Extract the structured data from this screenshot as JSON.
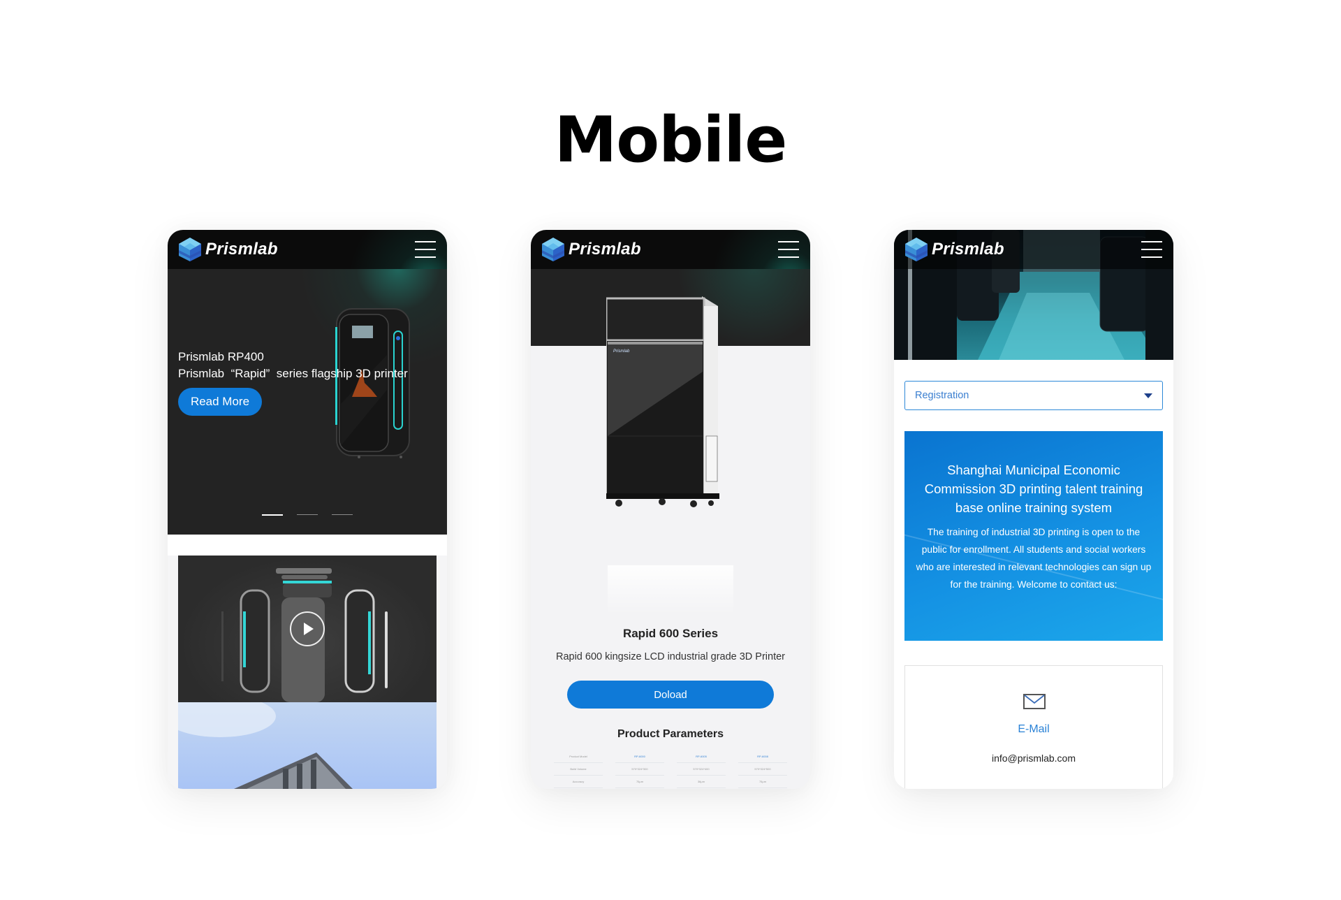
{
  "page": {
    "title": "Mobile"
  },
  "brand": {
    "name": "Prismlab",
    "accent": "#0f7ad8"
  },
  "phones": [
    {
      "header": {
        "logo": "Prismlab",
        "menu_icon": "hamburger-menu-icon"
      },
      "hero": {
        "line1": "Prismlab RP400",
        "line2": "Prismlab  “Rapid”  series flagship 3D printer",
        "button": "Read More",
        "slides": 3,
        "active_slide": 1
      },
      "video": {
        "icon": "play-icon"
      }
    },
    {
      "header": {
        "logo": "Prismlab",
        "menu_icon": "hamburger-menu-icon"
      },
      "product": {
        "title": "Rapid 600 Series",
        "subtitle": "Rapid 600 kingsize LCD industrial grade 3D Printer",
        "button": "Doload"
      },
      "params": {
        "title": "Product Parameters",
        "rows": [
          [
            "Product Model",
            "RP-6000",
            "RP-6005",
            "RP-6008"
          ],
          [
            "Build Volume",
            "570*324*300",
            "570*324*400",
            "570*324*500"
          ],
          [
            "Accuracy",
            "75μm",
            "36μm",
            "75μm"
          ]
        ]
      }
    },
    {
      "header": {
        "logo": "Prismlab",
        "menu_icon": "hamburger-menu-icon"
      },
      "select": {
        "value": "Registration",
        "icon": "caret-down-icon"
      },
      "info": {
        "title": "Shanghai Municipal Economic Commission 3D printing talent training base online training system",
        "body": "The training of industrial 3D printing is open to the public for enrollment. All students and social workers who are interested in relevant technologies can sign up for the training. Welcome to contact us:"
      },
      "contact": {
        "icon": "mail-icon",
        "label": "E-Mail",
        "value": "info@prismlab.com"
      }
    }
  ]
}
